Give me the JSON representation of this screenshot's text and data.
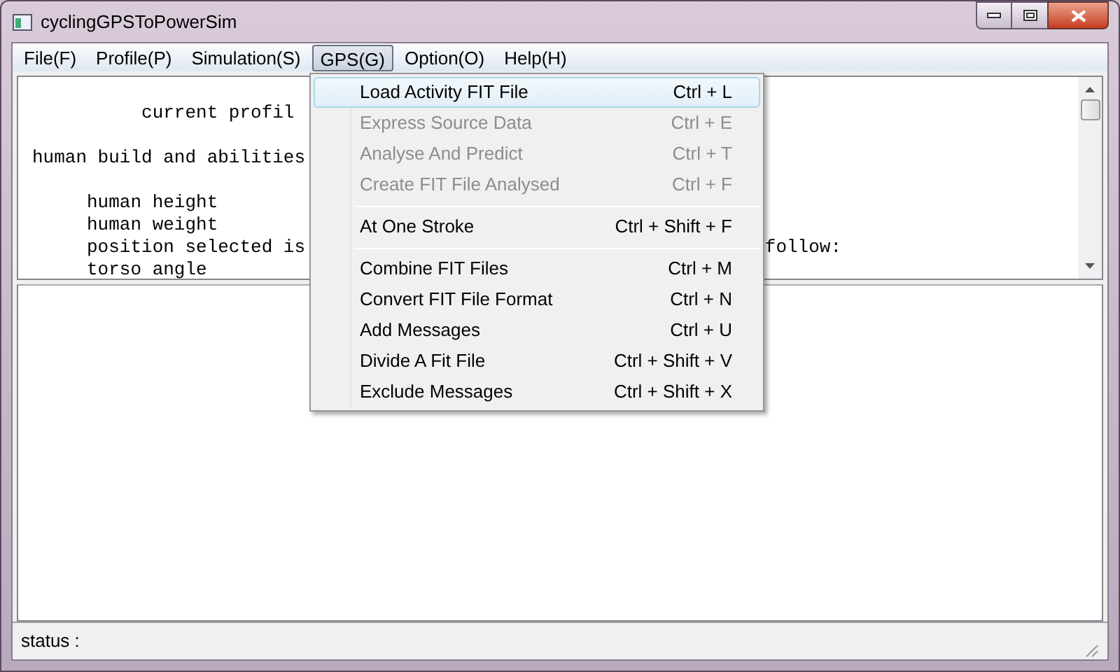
{
  "window": {
    "title": "cyclingGPSToPowerSim"
  },
  "menu_bar": [
    {
      "label": "File(F)",
      "selected": false
    },
    {
      "label": "Profile(P)",
      "selected": false
    },
    {
      "label": "Simulation(S)",
      "selected": false
    },
    {
      "label": "GPS(G)",
      "selected": true
    },
    {
      "label": "Option(O)",
      "selected": false
    },
    {
      "label": "Help(H)",
      "selected": false
    }
  ],
  "profile_text": [
    {
      "text": "          current profil"
    },
    {
      "text": "human build and abilities",
      "space_before": true
    },
    {
      "text": "     human height",
      "space_before": true
    },
    {
      "text": "     human weight"
    },
    {
      "text": "     position selected is",
      "tail": "follow:"
    },
    {
      "text": "     torso angle"
    }
  ],
  "gps_menu": [
    {
      "kind": "item",
      "label": "Load Activity FIT File",
      "shortcut": "Ctrl + L",
      "disabled": false,
      "selected": true
    },
    {
      "kind": "item",
      "label": "Express Source Data",
      "shortcut": "Ctrl + E",
      "disabled": true,
      "selected": false
    },
    {
      "kind": "item",
      "label": "Analyse And Predict",
      "shortcut": "Ctrl + T",
      "disabled": true,
      "selected": false
    },
    {
      "kind": "item",
      "label": "Create FIT File Analysed",
      "shortcut": "Ctrl + F",
      "disabled": true,
      "selected": false
    },
    {
      "kind": "separator"
    },
    {
      "kind": "item",
      "label": "At One Stroke",
      "shortcut": "Ctrl + Shift + F",
      "disabled": false,
      "selected": false
    },
    {
      "kind": "separator"
    },
    {
      "kind": "item",
      "label": "Combine FIT Files",
      "shortcut": "Ctrl + M",
      "disabled": false,
      "selected": false
    },
    {
      "kind": "item",
      "label": "Convert FIT File Format",
      "shortcut": "Ctrl + N",
      "disabled": false,
      "selected": false
    },
    {
      "kind": "item",
      "label": "Add Messages",
      "shortcut": "Ctrl + U",
      "disabled": false,
      "selected": false
    },
    {
      "kind": "item",
      "label": "Divide A Fit File",
      "shortcut": "Ctrl + Shift + V",
      "disabled": false,
      "selected": false
    },
    {
      "kind": "item",
      "label": "Exclude Messages",
      "shortcut": "Ctrl + Shift + X",
      "disabled": false,
      "selected": false
    }
  ],
  "status_bar": {
    "text": "status :"
  }
}
